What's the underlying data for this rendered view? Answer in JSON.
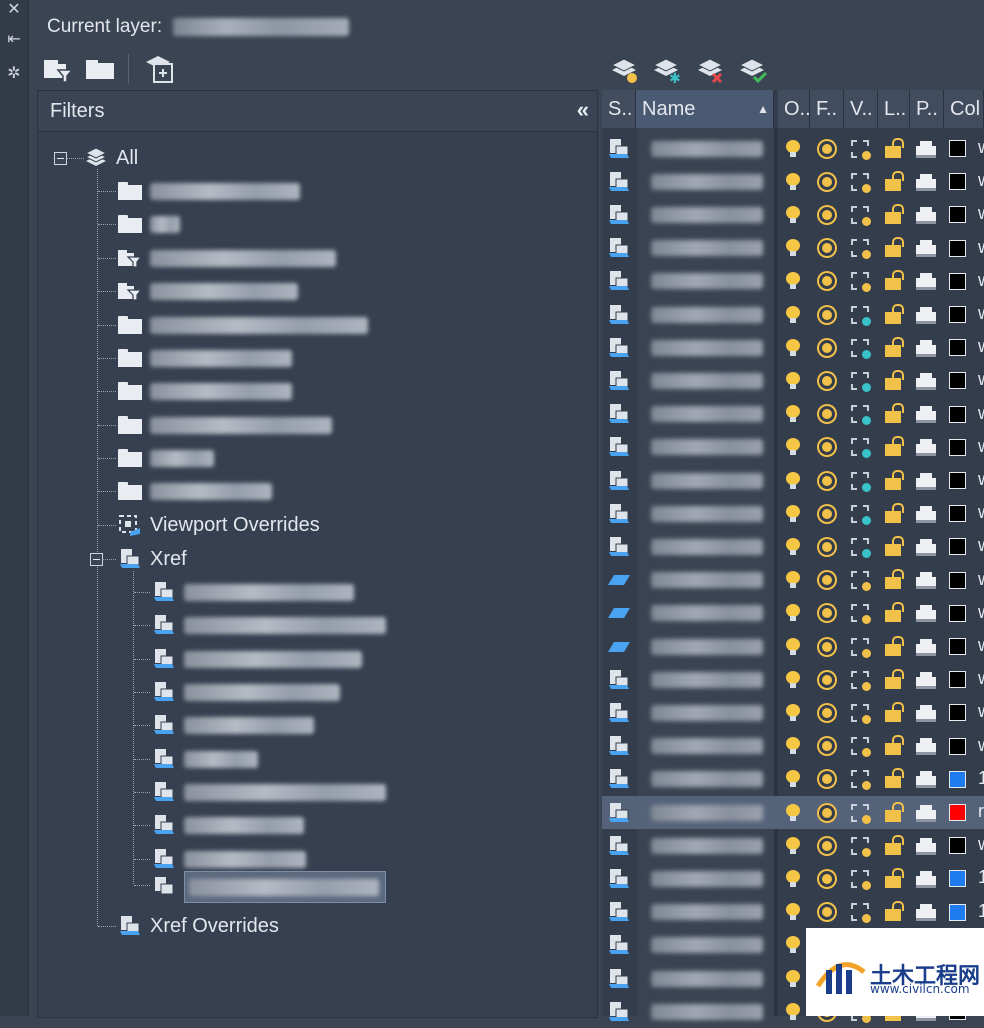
{
  "app": {
    "current_layer_label": "Current layer:",
    "filters_title": "Filters",
    "collapse_glyph": "«"
  },
  "tree": {
    "root_label": "All",
    "viewport_overrides": "Viewport Overrides",
    "xref": "Xref",
    "xref_overrides": "Xref Overrides"
  },
  "grid": {
    "headers": [
      "S..",
      "Name",
      "O..",
      "F..",
      "V..",
      "L..",
      "P..",
      "Col"
    ],
    "sort_indicator": "▲",
    "rows": [
      {
        "status": "xref",
        "color": "#000000",
        "colname": "w"
      },
      {
        "status": "xref",
        "color": "#000000",
        "colname": "w"
      },
      {
        "status": "xref",
        "color": "#000000",
        "colname": "w"
      },
      {
        "status": "xref",
        "color": "#000000",
        "colname": "w"
      },
      {
        "status": "xref",
        "color": "#000000",
        "colname": "w"
      },
      {
        "status": "xref",
        "color": "#000000",
        "colname": "w",
        "vpf": "teal"
      },
      {
        "status": "xref",
        "color": "#000000",
        "colname": "w",
        "vpf": "teal"
      },
      {
        "status": "xref",
        "color": "#000000",
        "colname": "w",
        "vpf": "teal"
      },
      {
        "status": "xref",
        "color": "#000000",
        "colname": "w",
        "vpf": "teal"
      },
      {
        "status": "xref",
        "color": "#000000",
        "colname": "w",
        "vpf": "teal"
      },
      {
        "status": "xref",
        "color": "#000000",
        "colname": "w",
        "vpf": "teal"
      },
      {
        "status": "xref",
        "color": "#000000",
        "colname": "w",
        "vpf": "teal"
      },
      {
        "status": "xref",
        "color": "#000000",
        "colname": "w",
        "vpf": "teal"
      },
      {
        "status": "plane",
        "color": "#000000",
        "colname": "w"
      },
      {
        "status": "plane",
        "color": "#000000",
        "colname": "w"
      },
      {
        "status": "plane",
        "color": "#000000",
        "colname": "w"
      },
      {
        "status": "xref",
        "color": "#000000",
        "colname": "w"
      },
      {
        "status": "xref",
        "color": "#000000",
        "colname": "w"
      },
      {
        "status": "xref",
        "color": "#000000",
        "colname": "w"
      },
      {
        "status": "xref",
        "color": "#1e7bf0",
        "colname": "1"
      },
      {
        "status": "xref",
        "color": "#ff0000",
        "colname": "r",
        "highlight": true
      },
      {
        "status": "xref",
        "color": "#000000",
        "colname": "w"
      },
      {
        "status": "xref",
        "color": "#1e7bf0",
        "colname": "1"
      },
      {
        "status": "xref",
        "color": "#1e7bf0",
        "colname": "1"
      },
      {
        "status": "xref",
        "color": "#000000",
        "colname": "w"
      },
      {
        "status": "xref",
        "color": "#000000",
        "colname": "w"
      },
      {
        "status": "xref",
        "color": "#000000",
        "colname": "w"
      }
    ]
  },
  "watermark": {
    "title": "土木工程网",
    "url": "www.civilcn.com"
  },
  "colors": {
    "bulb": "#f6c744",
    "lock": "#f2c14a",
    "teal": "#39c2c9"
  }
}
